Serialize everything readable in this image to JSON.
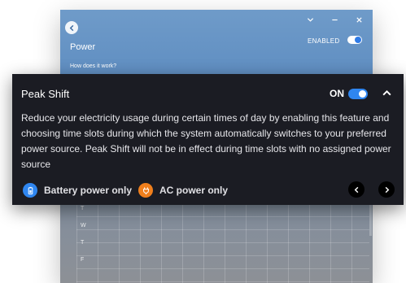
{
  "background_window": {
    "title": "Power",
    "enabled_label": "ENABLED",
    "help_link": "How does it work?",
    "days": [
      "T",
      "W",
      "T",
      "F"
    ]
  },
  "panel": {
    "title": "Peak Shift",
    "on_label": "ON",
    "description": "Reduce your electricity usage during certain times of day by enabling this feature and choosing time slots during which the system automatically switches to your preferred power source. Peak Shift will not be in effect during time slots with no assigned power source",
    "legend": [
      {
        "label": "Battery power only",
        "icon": "battery-icon",
        "color": "#2f86f0"
      },
      {
        "label": "AC power only",
        "icon": "plug-icon",
        "color": "#f07f1c"
      }
    ]
  },
  "colors": {
    "panel_bg": "#1b1c23",
    "toggle_on": "#2f86f0",
    "window_blue": "#5d8cc0"
  }
}
